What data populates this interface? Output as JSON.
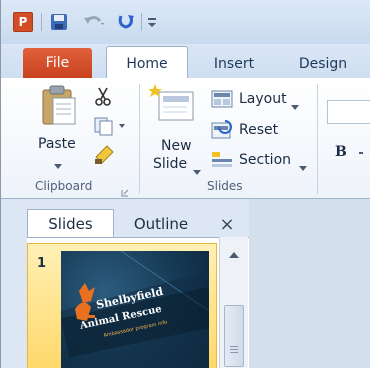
{
  "app": {
    "icon_letter": "P"
  },
  "ribbon_tabs": [
    {
      "label": "File"
    },
    {
      "label": "Home"
    },
    {
      "label": "Insert"
    },
    {
      "label": "Design"
    }
  ],
  "clipboard": {
    "paste_label": "Paste",
    "group_label": "Clipboard"
  },
  "slides_group": {
    "new_slide_line1": "New",
    "new_slide_line2": "Slide",
    "layout_label": "Layout",
    "reset_label": "Reset",
    "section_label": "Section",
    "group_label": "Slides"
  },
  "font_group": {
    "bold_label": "B"
  },
  "panel": {
    "tabs": [
      {
        "label": "Slides"
      },
      {
        "label": "Outline"
      }
    ],
    "close_glyph": "×",
    "slide_number": "1",
    "thumbnail": {
      "title_line1": "Shelbyfield",
      "title_line2": "Animal Rescue",
      "subtitle": "Ambassador program info"
    }
  },
  "colors": {
    "file_tab": "#d24d26",
    "selection": "#ffd86a",
    "ribbon_text": "#1e395b"
  },
  "icons": [
    "powerpoint-app-icon",
    "save-icon",
    "undo-icon",
    "redo-icon",
    "customize-qat-icon",
    "paste-icon",
    "cut-icon",
    "copy-icon",
    "format-painter-icon",
    "new-slide-icon",
    "layout-icon",
    "reset-icon",
    "section-icon",
    "scroll-up-icon"
  ]
}
